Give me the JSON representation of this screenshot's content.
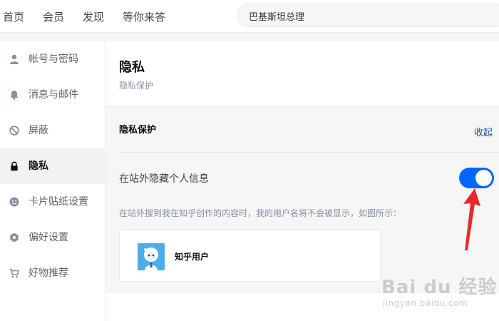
{
  "header": {
    "nav": [
      "首页",
      "会员",
      "发现",
      "等你来答"
    ],
    "search_value": "巴基斯坦总理"
  },
  "sidebar": {
    "items": [
      {
        "label": "帐号与密码",
        "icon": "user-icon",
        "active": false
      },
      {
        "label": "消息与邮件",
        "icon": "bell-icon",
        "active": false
      },
      {
        "label": "屏蔽",
        "icon": "block-icon",
        "active": false
      },
      {
        "label": "隐私",
        "icon": "lock-icon",
        "active": true
      },
      {
        "label": "卡片贴纸设置",
        "icon": "smiley-icon",
        "active": false
      },
      {
        "label": "偏好设置",
        "icon": "hexagon-icon",
        "active": false
      },
      {
        "label": "好物推荐",
        "icon": "cart-icon",
        "active": false
      }
    ]
  },
  "main": {
    "title": "隐私",
    "subtitle": "隐私保护",
    "section": {
      "title": "隐私保护",
      "collapse_label": "收起",
      "option_label": "在站外隐藏个人信息",
      "toggle_on": true,
      "description": "在站外搜到我在知乎创作的内容时，我的用户名将不会被显示，如图所示：",
      "preview_name": "知乎用户"
    }
  },
  "watermark": {
    "brand": "Bai du 经验",
    "url": "jingyan.baidu.com"
  },
  "colors": {
    "accent": "#0066ff",
    "link": "#175199",
    "annotation": "#e8292a",
    "avatar_bg": "#4aaee8"
  }
}
